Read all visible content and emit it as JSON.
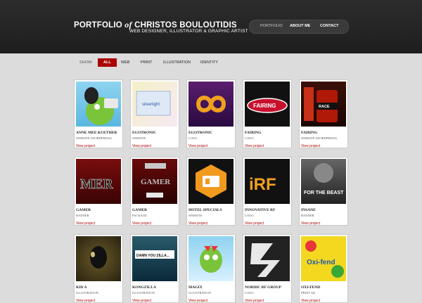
{
  "header": {
    "title_part1": "PORTFOLIO ",
    "title_of": "of",
    "title_part2": " CHRISTOS BOULOUTIDIS",
    "subtitle": "WEB DESIGNER, ILLUSTRATOR & GRAPHIC ARTIST",
    "nav": [
      "PORTFOLIO",
      "ABOUT ME",
      "CONTACT"
    ]
  },
  "filter": {
    "label": "SHOW:",
    "options": [
      "ALL",
      "WEB",
      "PRINT",
      "ILLUSTRATION",
      "IDENTITY"
    ],
    "active": "ALL"
  },
  "projects": [
    {
      "title": "ANNE MEE KUETHER",
      "category": "WEBSITE (WORDPRESS)",
      "link": "View project",
      "thumb_text": ""
    },
    {
      "title": "EGOTRONIC",
      "category": "WEBSITE",
      "link": "View project",
      "thumb_text": "silverlight"
    },
    {
      "title": "EGOTRONIC",
      "category": "LOGO",
      "link": "View project",
      "thumb_text": ""
    },
    {
      "title": "FAIRING",
      "category": "LOGO",
      "link": "View project",
      "thumb_text": "FAIRING"
    },
    {
      "title": "FAIRING",
      "category": "WEBSITE (WORDPRESS)",
      "link": "View project",
      "thumb_text": "RACE"
    },
    {
      "title": "GAMER",
      "category": "BANNER",
      "link": "View project",
      "thumb_text": "MER"
    },
    {
      "title": "GAMER",
      "category": "PACKAGE",
      "link": "View project",
      "thumb_text": "GAMER"
    },
    {
      "title": "HOTEL SPECIALS",
      "category": "WEBSITE",
      "link": "View project",
      "thumb_text": ""
    },
    {
      "title": "INNOVATIVE RF",
      "category": "LOGO",
      "link": "View project",
      "thumb_text": "iRF"
    },
    {
      "title": "INSANE",
      "category": "BANNER",
      "link": "View project",
      "thumb_text": "FOR THE BEAST"
    },
    {
      "title": "KID A",
      "category": "ILLUSTRATION",
      "link": "View project",
      "thumb_text": ""
    },
    {
      "title": "KONGZILLA",
      "category": "ILLUSTRATION",
      "link": "View project",
      "thumb_text": "DAMN YOU ZILLA..."
    },
    {
      "title": "MAGIX",
      "category": "ILLUSTRATION",
      "link": "View project",
      "thumb_text": ""
    },
    {
      "title": "NORDIC RF GROUP",
      "category": "LOGO",
      "link": "View project",
      "thumb_text": ""
    },
    {
      "title": "OXI-FEND",
      "category": "PRINT AD",
      "link": "View project",
      "thumb_text": "Oxi-fend"
    }
  ],
  "colors": {
    "accent": "#aa0000",
    "header_bg": "#222222",
    "page_bg": "#dcdcdc"
  }
}
